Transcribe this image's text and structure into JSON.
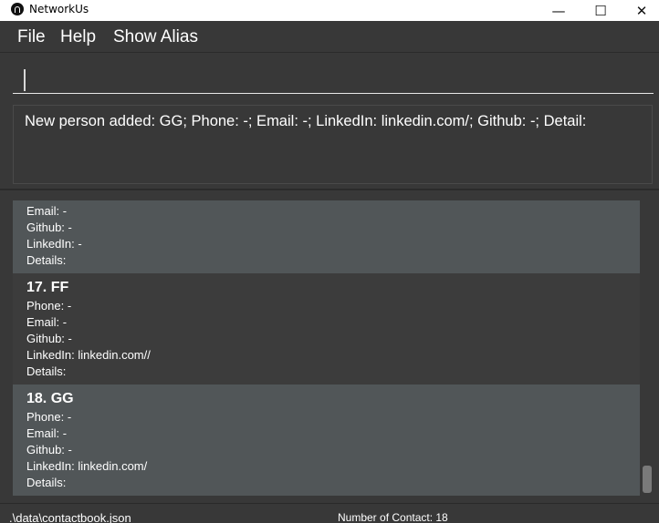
{
  "window": {
    "title": "NetworkUs",
    "minimize_glyph": "—",
    "maximize_glyph": "☐",
    "close_glyph": "✕"
  },
  "menu": {
    "items": [
      "File",
      "Help",
      "Show Alias"
    ]
  },
  "command_box": {
    "value": ""
  },
  "result_display": {
    "text": "New person added: GG; Phone: -; Email: -; LinkedIn: linkedin.com/; Github: -; Detail:"
  },
  "person_list": {
    "partial_card": {
      "email": "Email: -",
      "github": "Github: -",
      "linkedin": "LinkedIn: -",
      "details": "Details:"
    },
    "cards": [
      {
        "header": "17.  FF",
        "phone": "Phone: -",
        "email": "Email: -",
        "github": "Github: -",
        "linkedin": "LinkedIn: linkedin.com//",
        "details": "Details:"
      },
      {
        "header": "18.  GG",
        "phone": "Phone: -",
        "email": "Email: -",
        "github": "Github: -",
        "linkedin": "LinkedIn: linkedin.com/",
        "details": "Details:"
      }
    ]
  },
  "status_bar": {
    "file_path": ".\\data\\contactbook.json",
    "contact_count": "Number of Contact: 18"
  },
  "colors": {
    "background": "#383838",
    "card_light": "#515658",
    "card_dark": "#3c3c3c",
    "text": "#ffffff"
  }
}
